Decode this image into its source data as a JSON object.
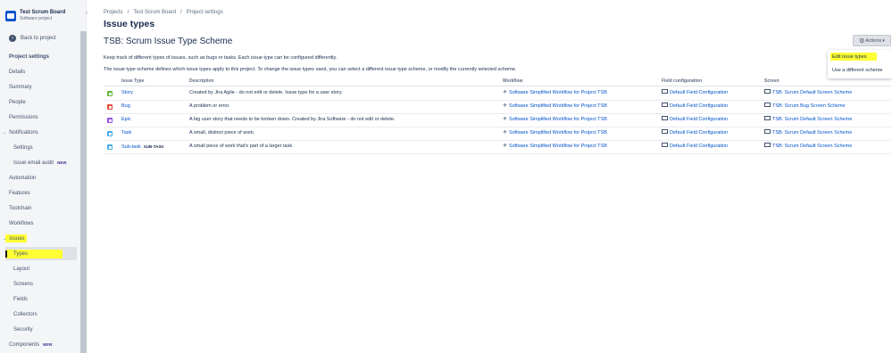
{
  "project": {
    "name": "Test Scrum Board",
    "type": "Software project"
  },
  "sidebar": {
    "back": "Back to project",
    "heading": "Project settings",
    "items": [
      {
        "label": "Details"
      },
      {
        "label": "Summary"
      },
      {
        "label": "People"
      },
      {
        "label": "Permissions"
      },
      {
        "label": "Notifications"
      },
      {
        "label": "Settings"
      },
      {
        "label": "Issue email audit",
        "badge": "NEW"
      },
      {
        "label": "Automation"
      },
      {
        "label": "Features"
      },
      {
        "label": "Toolchain"
      },
      {
        "label": "Workflows"
      },
      {
        "label": "Issues"
      },
      {
        "label": "Types"
      },
      {
        "label": "Layout"
      },
      {
        "label": "Screens"
      },
      {
        "label": "Fields"
      },
      {
        "label": "Collectors"
      },
      {
        "label": "Security"
      },
      {
        "label": "Components",
        "badge": "NEW"
      }
    ]
  },
  "breadcrumb": [
    "Projects",
    "Test Scrum Board",
    "Project settings"
  ],
  "page_title": "Issue types",
  "scheme_title": "TSB: Scrum Issue Type Scheme",
  "description_1": "Keep track of different types of issues, such as bugs or tasks. Each issue type can be configured differently.",
  "description_2": "The issue type scheme defines which issue types apply to this project. To change the issue types used, you can select a different issue type scheme, or modify the currently selected scheme.",
  "actions": {
    "label": "Actions",
    "menu": [
      "Edit issue types",
      "Use a different scheme"
    ]
  },
  "table": {
    "headers": [
      "Issue Type",
      "Description",
      "Workflow",
      "Field configuration",
      "Screen"
    ],
    "rows": [
      {
        "type": "Story",
        "color": "#63ba3c",
        "description": "Created by Jira Agile - do not edit or delete. Issue type for a user story.",
        "workflow": "Software Simplified Workflow for Project TSB",
        "field_config": "Default Field Configuration",
        "screen": "TSB: Scrum Default Screen Scheme"
      },
      {
        "type": "Bug",
        "color": "#e5493a",
        "description": "A problem or error.",
        "workflow": "Software Simplified Workflow for Project TSB",
        "field_config": "Default Field Configuration",
        "screen": "TSB: Scrum Bug Screen Scheme"
      },
      {
        "type": "Epic",
        "color": "#904ee2",
        "description": "A big user story that needs to be broken down. Created by Jira Software - do not edit or delete.",
        "workflow": "Software Simplified Workflow for Project TSB",
        "field_config": "Default Field Configuration",
        "screen": "TSB: Scrum Default Screen Scheme"
      },
      {
        "type": "Task",
        "color": "#4bade8",
        "description": "A small, distinct piece of work.",
        "workflow": "Software Simplified Workflow for Project TSB",
        "field_config": "Default Field Configuration",
        "screen": "TSB: Scrum Default Screen Scheme"
      },
      {
        "type": "Sub-task",
        "badge": "SUB-TASK",
        "color": "#4bade8",
        "description": "A small piece of work that's part of a larger task.",
        "workflow": "Software Simplified Workflow for Project TSB",
        "field_config": "Default Field Configuration",
        "screen": "TSB: Scrum Default Screen Scheme"
      }
    ]
  }
}
